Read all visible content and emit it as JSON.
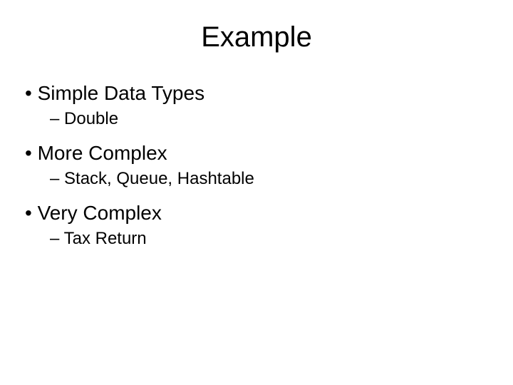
{
  "title": "Example",
  "items": [
    {
      "label": "Simple Data Types",
      "sub": "Double"
    },
    {
      "label": "More Complex",
      "sub": "Stack, Queue, Hashtable"
    },
    {
      "label": "Very Complex",
      "sub": "Tax Return"
    }
  ]
}
